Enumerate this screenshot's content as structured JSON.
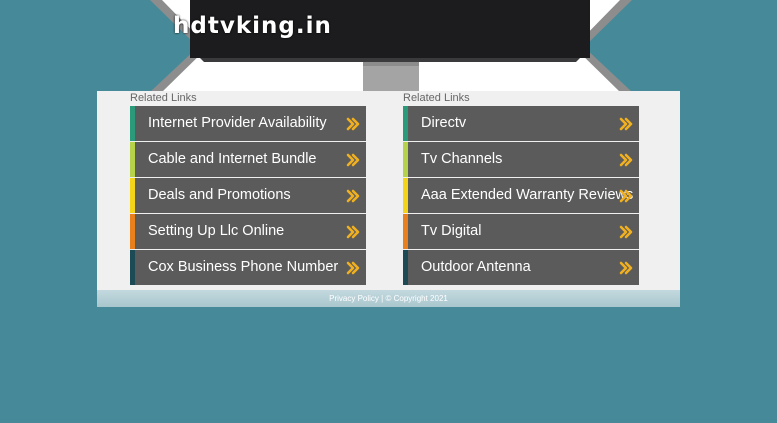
{
  "site": {
    "title": "hdtvking.in"
  },
  "columns": [
    {
      "heading": "Related Links",
      "links": [
        {
          "label": "Internet Provider Availability",
          "accent": "#2a9a7b"
        },
        {
          "label": "Cable and Internet Bundle",
          "accent": "#b6d24a"
        },
        {
          "label": "Deals and Promotions",
          "accent": "#f3d418"
        },
        {
          "label": "Setting Up Llc Online",
          "accent": "#e8801e"
        },
        {
          "label": "Cox Business Phone Number",
          "accent": "#1c4a55"
        }
      ]
    },
    {
      "heading": "Related Links",
      "links": [
        {
          "label": "Directv",
          "accent": "#2a9a7b"
        },
        {
          "label": "Tv Channels",
          "accent": "#b6d24a"
        },
        {
          "label": "Aaa Extended Warranty Reviews",
          "accent": "#f3d418"
        },
        {
          "label": "Tv Digital",
          "accent": "#e8801e"
        },
        {
          "label": "Outdoor Antenna",
          "accent": "#1c4a55"
        }
      ]
    }
  ],
  "footer": {
    "privacy_label": "Privacy Policy",
    "separator": " | ",
    "copyright": "© Copyright 2021"
  },
  "colors": {
    "background": "#468a99",
    "tile": "#5b5b5b",
    "arrow": "#f0b020",
    "panel": "#f0f0f0"
  },
  "icons": {
    "link_arrow": "double-chevron-right-icon"
  }
}
